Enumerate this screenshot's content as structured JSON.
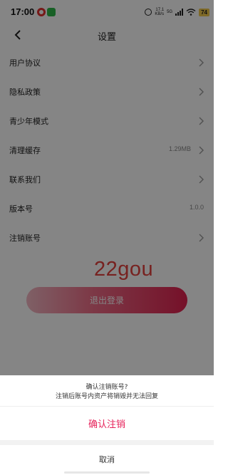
{
  "status_bar": {
    "time": "17:00",
    "speed_top": "17.1",
    "speed_bottom": "KB/s",
    "network": "5G",
    "battery": "74"
  },
  "nav": {
    "title": "设置"
  },
  "menu": {
    "user_agreement": "用户协议",
    "privacy_policy": "隐私政策",
    "teen_mode": "青少年模式",
    "clear_cache": "清理缓存",
    "cache_size": "1.29MB",
    "contact_us": "联系我们",
    "version_label": "版本号",
    "version_value": "1.0.0",
    "delete_account": "注销账号"
  },
  "watermark": "22gou",
  "logout_label": "退出登录",
  "sheet": {
    "title": "确认注销账号?",
    "message": "注销后账号内资产将销毁并无法回复",
    "confirm_label": "确认注销",
    "cancel_label": "取消"
  },
  "colors": {
    "accent": "#e6225a",
    "watermark": "#e4423e",
    "overlay": "rgba(0,0,0,0.48)"
  }
}
